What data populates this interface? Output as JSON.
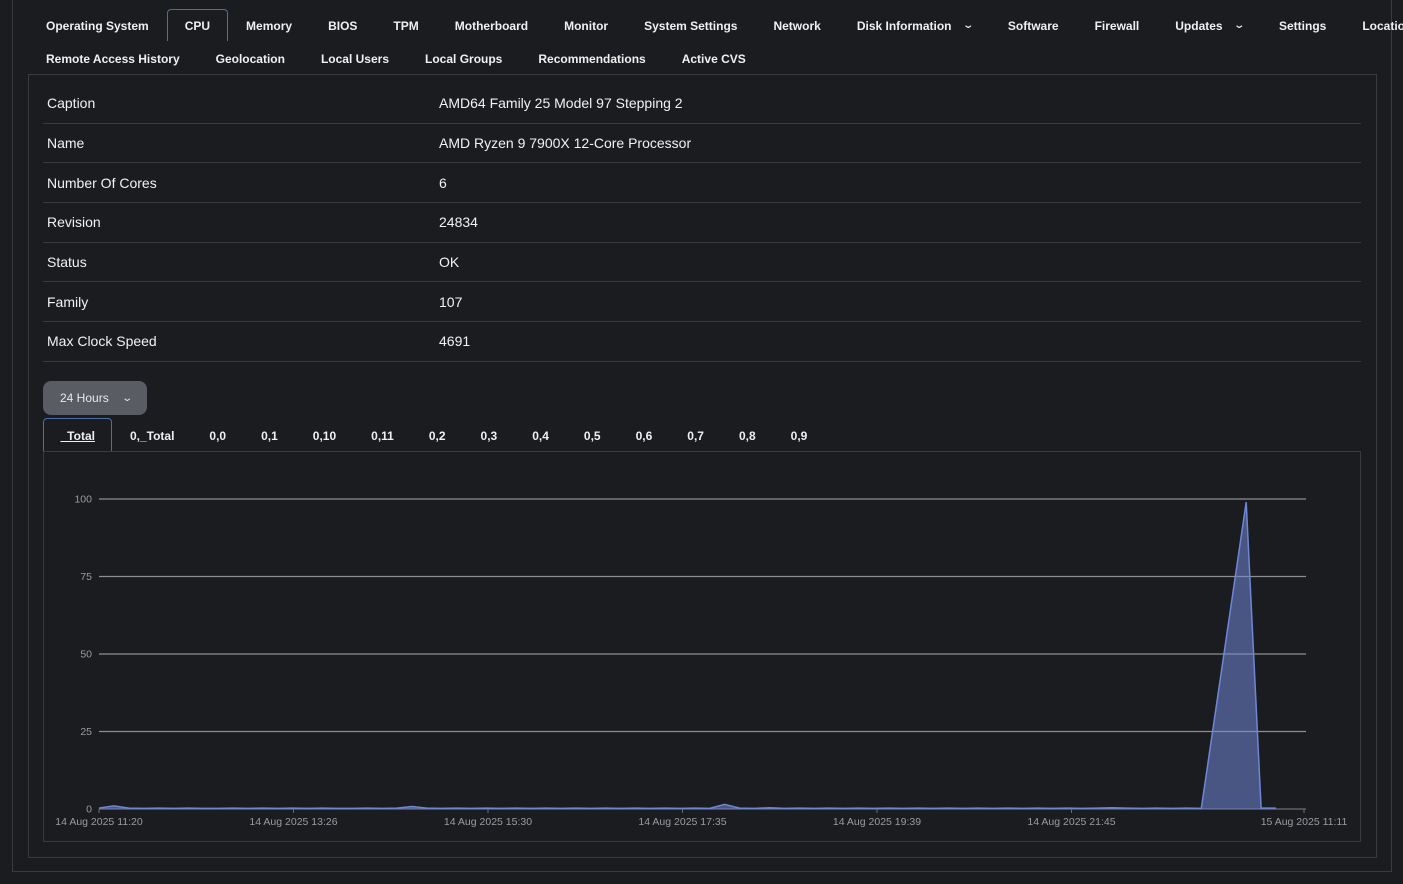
{
  "nav": {
    "row1": [
      {
        "label": "Operating System",
        "name": "tab-operating-system"
      },
      {
        "label": "CPU",
        "name": "tab-cpu",
        "active": true
      },
      {
        "label": "Memory",
        "name": "tab-memory"
      },
      {
        "label": "BIOS",
        "name": "tab-bios"
      },
      {
        "label": "TPM",
        "name": "tab-tpm"
      },
      {
        "label": "Motherboard",
        "name": "tab-motherboard"
      },
      {
        "label": "Monitor",
        "name": "tab-monitor"
      },
      {
        "label": "System Settings",
        "name": "tab-system-settings"
      },
      {
        "label": "Network",
        "name": "tab-network"
      },
      {
        "label": "Disk Information",
        "name": "tab-disk-information",
        "dropdown": true
      },
      {
        "label": "Software",
        "name": "tab-software"
      },
      {
        "label": "Firewall",
        "name": "tab-firewall"
      },
      {
        "label": "Updates",
        "name": "tab-updates",
        "dropdown": true
      },
      {
        "label": "Settings",
        "name": "tab-settings"
      },
      {
        "label": "Location",
        "name": "tab-location"
      }
    ],
    "row2": [
      {
        "label": "Remote Access History",
        "name": "tab-remote-access-history"
      },
      {
        "label": "Geolocation",
        "name": "tab-geolocation"
      },
      {
        "label": "Local Users",
        "name": "tab-local-users"
      },
      {
        "label": "Local Groups",
        "name": "tab-local-groups"
      },
      {
        "label": "Recommendations",
        "name": "tab-recommendations"
      },
      {
        "label": "Active CVS",
        "name": "tab-active-cvs"
      }
    ]
  },
  "cpu_info": [
    {
      "key": "Caption",
      "value": "AMD64 Family 25 Model 97 Stepping 2"
    },
    {
      "key": "Name",
      "value": "AMD Ryzen 9 7900X 12-Core Processor"
    },
    {
      "key": "Number Of Cores",
      "value": "6"
    },
    {
      "key": "Revision",
      "value": "24834"
    },
    {
      "key": "Status",
      "value": "OK"
    },
    {
      "key": "Family",
      "value": "107"
    },
    {
      "key": "Max Clock Speed",
      "value": "4691"
    }
  ],
  "time_range": {
    "label": "24 Hours"
  },
  "series_tabs": [
    "_Total",
    "0,_Total",
    "0,0",
    "0,1",
    "0,10",
    "0,11",
    "0,2",
    "0,3",
    "0,4",
    "0,5",
    "0,6",
    "0,7",
    "0,8",
    "0,9"
  ],
  "colors": {
    "accent": "#4a6fa5",
    "series": "#6f86d6",
    "grid": "#8e8f94"
  },
  "chart_data": {
    "type": "area",
    "title": "",
    "xlabel": "",
    "ylabel": "",
    "ylim": [
      0,
      100
    ],
    "yticks": [
      0,
      25,
      50,
      75,
      100
    ],
    "xticks": [
      "14 Aug 2025 11:20",
      "14 Aug 2025 13:26",
      "14 Aug 2025 15:30",
      "14 Aug 2025 17:35",
      "14 Aug 2025 19:39",
      "14 Aug 2025 21:45",
      "15 Aug 2025 11:11"
    ],
    "grid": true,
    "series": [
      {
        "values": [
          0.3,
          1,
          0.3,
          0.2,
          0.3,
          0.2,
          0.3,
          0.2,
          0.2,
          0.3,
          0.2,
          0.3,
          0.2,
          0.3,
          0.2,
          0.3,
          0.2,
          0.2,
          0.3,
          0.2,
          0.3,
          0.8,
          0.3,
          0.2,
          0.3,
          0.2,
          0.3,
          0.2,
          0.3,
          0.2,
          0.3,
          0.2,
          0.3,
          0.2,
          0.3,
          0.2,
          0.3,
          0.2,
          0.3,
          0.2,
          0.3,
          0.2,
          1.5,
          0.3,
          0.2,
          0.4,
          0.2,
          0.3,
          0.2,
          0.3,
          0.2,
          0.3,
          0.2,
          0.3,
          0.2,
          0.3,
          0.2,
          0.3,
          0.2,
          0.3,
          0.2,
          0.3,
          0.2,
          0.3,
          0.2,
          0.3,
          0.2,
          0.3,
          0.4,
          0.3,
          0.2,
          0.3,
          0.2,
          0.3,
          0.2,
          99,
          0.3,
          0.3
        ]
      }
    ]
  }
}
